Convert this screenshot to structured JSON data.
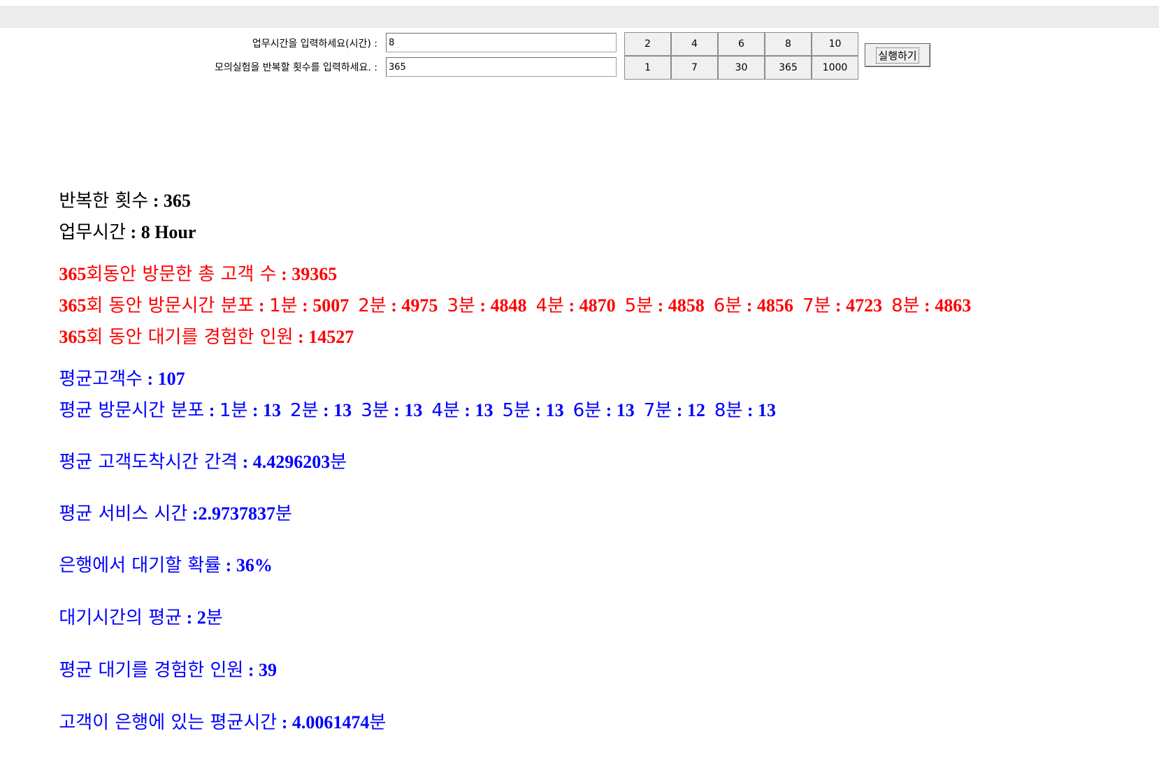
{
  "form": {
    "work_hours_label": "업무시간을 입력하세요(시간) :",
    "work_hours_value": "8",
    "repeat_label": "모의실험을 반복할 횟수를 입력하세요. :",
    "repeat_value": "365",
    "hour_buttons": [
      "2",
      "4",
      "6",
      "8",
      "10"
    ],
    "repeat_buttons": [
      "1",
      "7",
      "30",
      "365",
      "1000"
    ],
    "run_label": "실행하기"
  },
  "summary": {
    "repeat_count": {
      "label": "반복한 횟수",
      "value": " : 365"
    },
    "work_time": {
      "label": "업무시간",
      "value": " : 8 Hour"
    }
  },
  "totals": {
    "total_customers": {
      "prefix": "365",
      "label": "회동안 방문한 총 고객 수",
      "value": " : 39365"
    },
    "visit_distribution": {
      "prefix": "365",
      "label": "회 동안 방문시간 분포",
      "items": [
        {
          "label": "1분",
          "value": "5007"
        },
        {
          "label": "2분",
          "value": "4975"
        },
        {
          "label": "3분",
          "value": "4848"
        },
        {
          "label": "4분",
          "value": "4870"
        },
        {
          "label": "5분",
          "value": "4858"
        },
        {
          "label": "6분",
          "value": "4856"
        },
        {
          "label": "7분",
          "value": "4723"
        },
        {
          "label": "8분",
          "value": "4863"
        }
      ]
    },
    "waited_people": {
      "prefix": "365",
      "label": "회 동안 대기를 경험한 인원",
      "value": " : 14527"
    }
  },
  "averages": {
    "avg_customers": {
      "label": "평균고객수",
      "value": " : 107"
    },
    "avg_visit_distribution": {
      "label": "평균 방문시간 분포",
      "items": [
        {
          "label": "1분",
          "value": "13"
        },
        {
          "label": "2분",
          "value": "13"
        },
        {
          "label": "3분",
          "value": "13"
        },
        {
          "label": "4분",
          "value": "13"
        },
        {
          "label": "5분",
          "value": "13"
        },
        {
          "label": "6분",
          "value": "13"
        },
        {
          "label": "7분",
          "value": "12"
        },
        {
          "label": "8분",
          "value": "13"
        }
      ]
    },
    "avg_arrival_interval": {
      "label": "평균 고객도착시간 간격",
      "value": " : 4.4296203",
      "unit": "분"
    },
    "avg_service_time": {
      "label": "평균 서비스 시간",
      "value": " :2.9737837",
      "unit": "분"
    },
    "wait_probability": {
      "label": "은행에서 대기할 확률",
      "value": " : 36%"
    },
    "avg_wait_time": {
      "label": "대기시간의 평균",
      "value": " : 2",
      "unit": "분"
    },
    "avg_waited_people": {
      "label": "평균 대기를 경험한 인원",
      "value": " : 39"
    },
    "avg_time_in_bank": {
      "label": "고객이 은행에 있는 평균시간",
      "value": " : 4.0061474",
      "unit": "분"
    }
  },
  "colors": {
    "summary": "#000000",
    "totals": "#ff0000",
    "averages": "#0000ff"
  }
}
